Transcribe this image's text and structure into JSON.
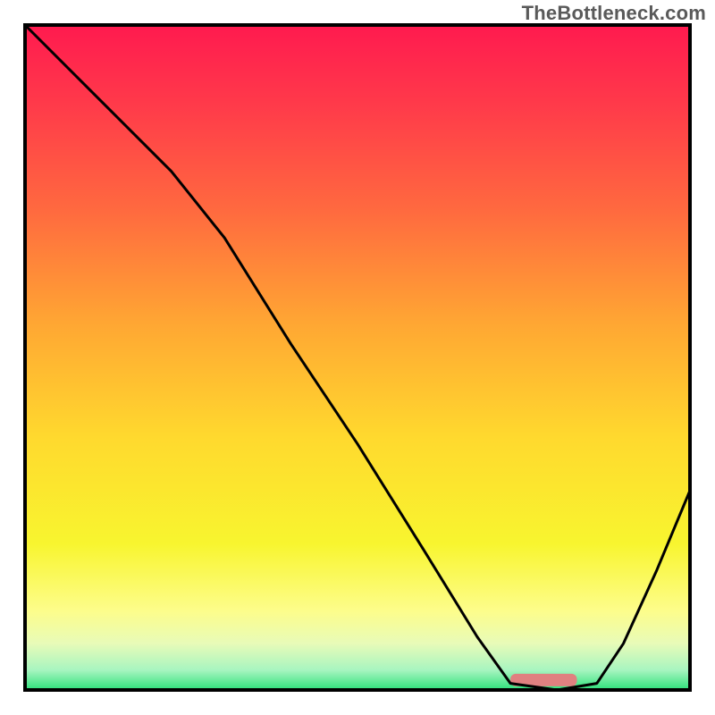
{
  "watermark": "TheBottleneck.com",
  "chart_data": {
    "type": "line",
    "title": "",
    "xlabel": "",
    "ylabel": "",
    "xlim": [
      0,
      100
    ],
    "ylim": [
      0,
      100
    ],
    "grid": false,
    "legend": false,
    "series": [
      {
        "name": "bottleneck-curve",
        "x": [
          0,
          10,
          22,
          30,
          40,
          50,
          60,
          68,
          73,
          80,
          86,
          90,
          95,
          100
        ],
        "values": [
          100,
          90,
          78,
          68,
          52,
          37,
          21,
          8,
          1,
          0,
          1,
          7,
          18,
          30
        ]
      }
    ],
    "valley_marker": {
      "x_start": 73,
      "x_end": 83,
      "y": 1.5,
      "color": "#e08080"
    },
    "gradient_stops": [
      {
        "offset": 0.0,
        "color": "#ff1a4f"
      },
      {
        "offset": 0.12,
        "color": "#ff3a4a"
      },
      {
        "offset": 0.28,
        "color": "#ff6a3f"
      },
      {
        "offset": 0.45,
        "color": "#ffa733"
      },
      {
        "offset": 0.62,
        "color": "#ffd92e"
      },
      {
        "offset": 0.78,
        "color": "#f8f52f"
      },
      {
        "offset": 0.88,
        "color": "#fdfd8a"
      },
      {
        "offset": 0.93,
        "color": "#e8fbb8"
      },
      {
        "offset": 0.97,
        "color": "#a8f5c0"
      },
      {
        "offset": 1.0,
        "color": "#2de07a"
      }
    ],
    "frame_color": "#000000",
    "curve_color": "#000000",
    "curve_width": 3
  },
  "plot_geometry": {
    "outer_w": 800,
    "outer_h": 800,
    "inner_x": 28,
    "inner_y": 28,
    "inner_w": 744,
    "inner_h": 744
  }
}
